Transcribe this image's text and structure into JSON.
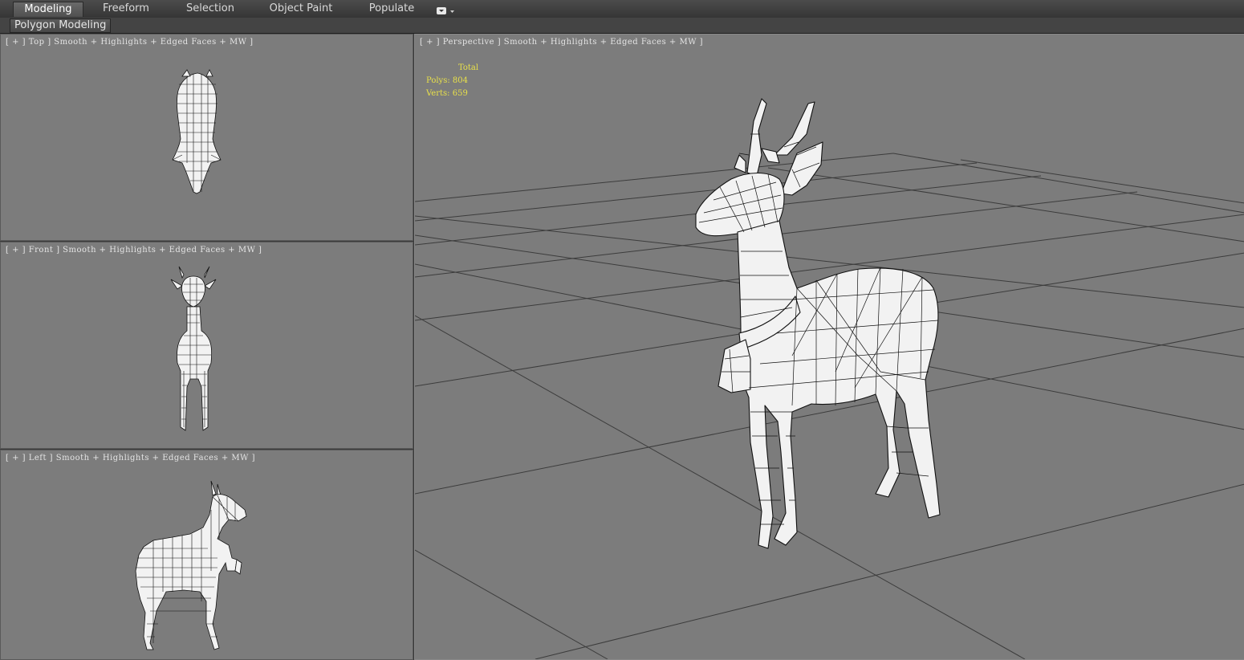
{
  "ribbon": {
    "tabs": [
      {
        "label": "Modeling",
        "active": true
      },
      {
        "label": "Freeform",
        "active": false
      },
      {
        "label": "Selection",
        "active": false
      },
      {
        "label": "Object Paint",
        "active": false
      },
      {
        "label": "Populate",
        "active": false
      }
    ],
    "dropdown_icon": "ribbon-options-icon",
    "panel_label": "Polygon Modeling"
  },
  "viewports": {
    "top": {
      "label": "[ + ] Top ] Smooth + Highlights + Edged Faces + MW ]"
    },
    "front": {
      "label": "[ + ] Front ] Smooth + Highlights + Edged Faces + MW ]"
    },
    "left": {
      "label": "[ + ] Left ] Smooth + Highlights + Edged Faces + MW ]"
    },
    "perspective": {
      "label": "[ + ] Perspective ] Smooth + Highlights + Edged Faces + MW ]",
      "stats": {
        "total_label": "Total",
        "polys_label": "Polys:",
        "polys_value": "804",
        "verts_label": "Verts:",
        "verts_value": "659"
      }
    }
  },
  "colors": {
    "viewport_bg": "#7c7c7c",
    "stats_text": "#e8e04a",
    "mesh_fill": "#f2f2f2",
    "mesh_wire": "#111111",
    "grid_line": "#3c3c3c"
  }
}
